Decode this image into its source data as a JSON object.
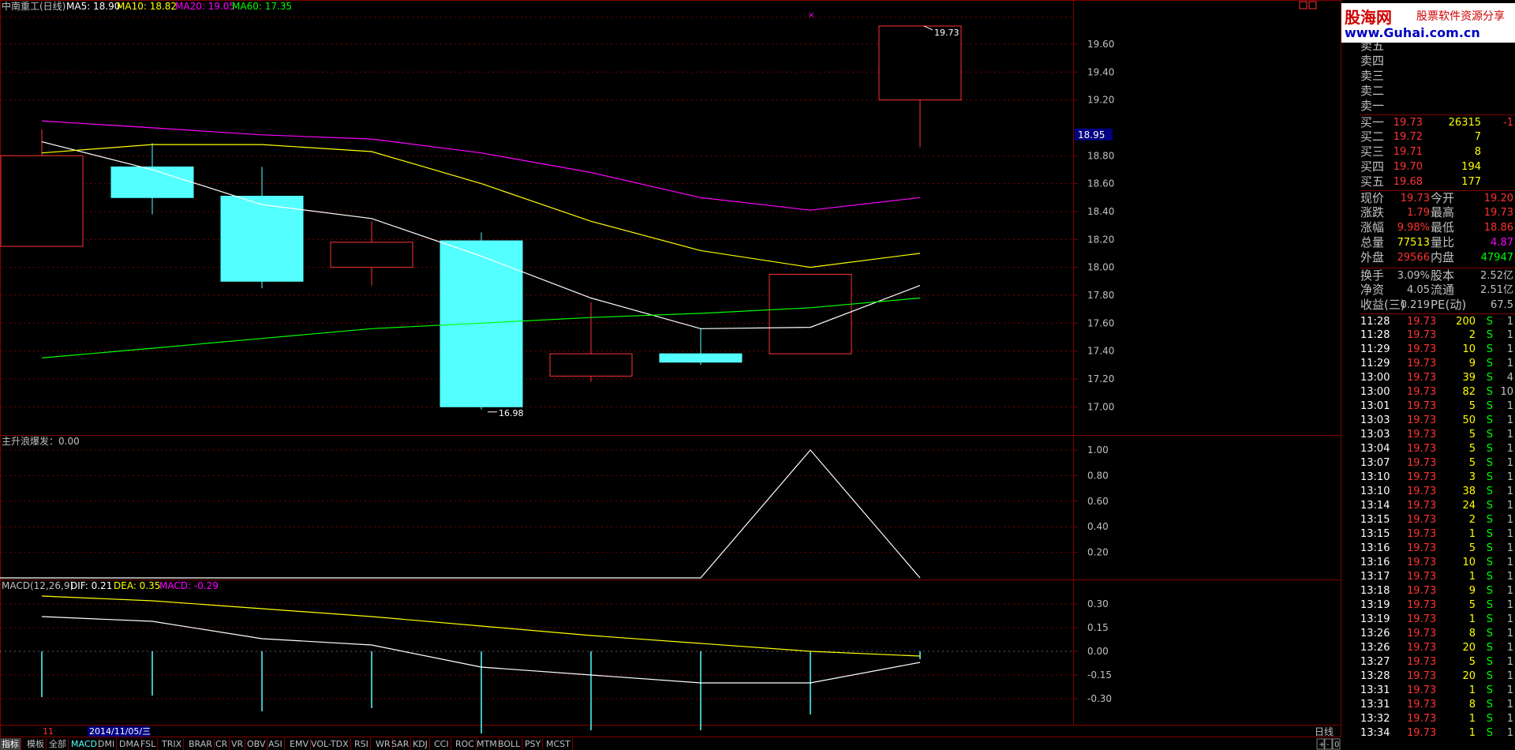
{
  "header": {
    "stock_name": "中南重工(日线)",
    "ma_labels": [
      {
        "text": "MA5: 18.90",
        "color": "#ffffff"
      },
      {
        "text": "MA10: 18.82",
        "color": "#ffff00"
      },
      {
        "text": "MA20: 19.05",
        "color": "#ff00ff"
      },
      {
        "text": "MA60: 17.35",
        "color": "#00ff00"
      }
    ]
  },
  "logo": {
    "title": "股海网",
    "subtitle": "股票软件资源分享",
    "url": "www.Guhai.com.cn"
  },
  "price_axis": {
    "ticks": [
      "19.60",
      "19.40",
      "19.20",
      "18.95",
      "18.80",
      "18.60",
      "18.40",
      "18.20",
      "18.00",
      "17.80",
      "17.60",
      "17.40",
      "17.20",
      "17.00"
    ],
    "highlight": "18.95"
  },
  "candles": [
    {
      "o": 18.8,
      "c": 18.15,
      "h": 18.99,
      "l": 18.15,
      "up": true
    },
    {
      "o": 18.72,
      "c": 18.5,
      "h": 18.89,
      "l": 18.38,
      "up": false
    },
    {
      "o": 18.51,
      "c": 17.9,
      "h": 18.72,
      "l": 17.85,
      "up": false
    },
    {
      "o": 18.0,
      "c": 18.18,
      "h": 18.33,
      "l": 17.87,
      "up": true
    },
    {
      "o": 18.19,
      "c": 17.0,
      "h": 18.25,
      "l": 16.98,
      "up": false
    },
    {
      "o": 17.22,
      "c": 17.38,
      "h": 17.75,
      "l": 17.18,
      "up": true
    },
    {
      "o": 17.38,
      "c": 17.32,
      "h": 17.56,
      "l": 17.3,
      "up": false
    },
    {
      "o": 17.38,
      "c": 17.95,
      "h": 17.95,
      "l": 17.38,
      "up": true
    },
    {
      "o": 19.2,
      "c": 19.73,
      "h": 19.73,
      "l": 18.86,
      "up": true
    }
  ],
  "ma_series": {
    "ma5": [
      18.9,
      18.7,
      18.45,
      18.35,
      18.08,
      17.78,
      17.56,
      17.57,
      17.87
    ],
    "ma10": [
      18.82,
      18.88,
      18.88,
      18.83,
      18.6,
      18.33,
      18.12,
      18.0,
      18.1
    ],
    "ma20": [
      19.05,
      19.0,
      18.95,
      18.92,
      18.82,
      18.68,
      18.5,
      18.41,
      18.5
    ],
    "ma60": [
      17.35,
      17.42,
      17.49,
      17.56,
      17.6,
      17.64,
      17.67,
      17.71,
      17.78
    ]
  },
  "annotations": {
    "high_label": "19.73",
    "low_label": "16.98"
  },
  "indicator1": {
    "label": "主升浪爆发：0.00",
    "ticks": [
      "1.00",
      "0.80",
      "0.60",
      "0.40",
      "0.20"
    ],
    "values": [
      0,
      0,
      0,
      0,
      0,
      0,
      0,
      1,
      0
    ]
  },
  "indicator2": {
    "label_name": "MACD(12,26,9)",
    "dif_label": "DIF: 0.21",
    "dea_label": "DEA: 0.35",
    "macd_label": "MACD: -0.29",
    "ticks": [
      "0.30",
      "0.15",
      "0.00",
      "-0.15",
      "-0.30"
    ],
    "dif": [
      0.22,
      0.19,
      0.08,
      0.04,
      -0.1,
      -0.15,
      -0.2,
      -0.2,
      -0.07
    ],
    "dea": [
      0.35,
      0.32,
      0.27,
      0.22,
      0.16,
      0.1,
      0.05,
      0.0,
      -0.03
    ],
    "macd": [
      -0.29,
      -0.28,
      -0.38,
      -0.36,
      -0.52,
      -0.5,
      -0.5,
      -0.4,
      -0.05
    ]
  },
  "date_bar": {
    "month": "11",
    "date": "2014/11/05/三"
  },
  "tabs": [
    "指标",
    "模板",
    "全部",
    "MACD",
    "DMI",
    "DMA",
    "FSL",
    "TRIX",
    "BRAR",
    "CR",
    "VR",
    "OBV",
    "ASI",
    "EMV",
    "VOL-TDX",
    "RSI",
    "WR",
    "SAR",
    "KDJ",
    "CCI",
    "ROC",
    "MTM",
    "BOLL",
    "PSY",
    "MCST"
  ],
  "active_tab": "MACD",
  "period_label": "日线",
  "corner_buttons": [
    "+",
    "-",
    "0"
  ],
  "orderbook": {
    "asks": [
      "卖五",
      "卖四",
      "卖三",
      "卖二",
      "卖一"
    ],
    "bids": [
      {
        "label": "买一",
        "price": "19.73",
        "vol": "26315",
        "chg": "-1"
      },
      {
        "label": "买二",
        "price": "19.72",
        "vol": "7",
        "chg": ""
      },
      {
        "label": "买三",
        "price": "19.71",
        "vol": "8",
        "chg": ""
      },
      {
        "label": "买四",
        "price": "19.70",
        "vol": "194",
        "chg": ""
      },
      {
        "label": "买五",
        "price": "19.68",
        "vol": "177",
        "chg": ""
      }
    ]
  },
  "quote": [
    {
      "l1": "现价",
      "v1": "19.73",
      "c1": "#ff3232",
      "l2": "今开",
      "v2": "19.20",
      "c2": "#ff3232"
    },
    {
      "l1": "涨跌",
      "v1": "1.79",
      "c1": "#ff3232",
      "l2": "最高",
      "v2": "19.73",
      "c2": "#ff3232"
    },
    {
      "l1": "涨幅",
      "v1": "9.98%",
      "c1": "#ff3232",
      "l2": "最低",
      "v2": "18.86",
      "c2": "#ff3232"
    },
    {
      "l1": "总量",
      "v1": "77513",
      "c1": "#ffff00",
      "l2": "量比",
      "v2": "4.87",
      "c2": "#ff00ff"
    },
    {
      "l1": "外盘",
      "v1": "29566",
      "c1": "#ff3232",
      "l2": "内盘",
      "v2": "47947",
      "c2": "#00ff00"
    }
  ],
  "fundamentals": [
    {
      "l1": "换手",
      "v1": "3.09%",
      "l2": "股本",
      "v2": "2.52亿"
    },
    {
      "l1": "净资",
      "v1": "4.05",
      "l2": "流通",
      "v2": "2.51亿"
    },
    {
      "l1": "收益(三)",
      "v1": "0.219",
      "l2": "PE(动)",
      "v2": "67.5"
    }
  ],
  "ticks": [
    {
      "t": "11:28",
      "p": "19.73",
      "v": "200",
      "s": "S",
      "n": "1"
    },
    {
      "t": "11:28",
      "p": "19.73",
      "v": "2",
      "s": "S",
      "n": "1"
    },
    {
      "t": "11:29",
      "p": "19.73",
      "v": "10",
      "s": "S",
      "n": "1"
    },
    {
      "t": "11:29",
      "p": "19.73",
      "v": "9",
      "s": "S",
      "n": "1"
    },
    {
      "t": "13:00",
      "p": "19.73",
      "v": "39",
      "s": "S",
      "n": "4"
    },
    {
      "t": "13:00",
      "p": "19.73",
      "v": "82",
      "s": "S",
      "n": "10"
    },
    {
      "t": "13:01",
      "p": "19.73",
      "v": "5",
      "s": "S",
      "n": "1"
    },
    {
      "t": "13:03",
      "p": "19.73",
      "v": "50",
      "s": "S",
      "n": "1"
    },
    {
      "t": "13:03",
      "p": "19.73",
      "v": "5",
      "s": "S",
      "n": "1"
    },
    {
      "t": "13:04",
      "p": "19.73",
      "v": "5",
      "s": "S",
      "n": "1"
    },
    {
      "t": "13:07",
      "p": "19.73",
      "v": "5",
      "s": "S",
      "n": "1"
    },
    {
      "t": "13:10",
      "p": "19.73",
      "v": "3",
      "s": "S",
      "n": "1"
    },
    {
      "t": "13:10",
      "p": "19.73",
      "v": "38",
      "s": "S",
      "n": "1"
    },
    {
      "t": "13:14",
      "p": "19.73",
      "v": "24",
      "s": "S",
      "n": "1"
    },
    {
      "t": "13:15",
      "p": "19.73",
      "v": "2",
      "s": "S",
      "n": "1"
    },
    {
      "t": "13:15",
      "p": "19.73",
      "v": "1",
      "s": "S",
      "n": "1"
    },
    {
      "t": "13:16",
      "p": "19.73",
      "v": "5",
      "s": "S",
      "n": "1"
    },
    {
      "t": "13:16",
      "p": "19.73",
      "v": "10",
      "s": "S",
      "n": "1"
    },
    {
      "t": "13:17",
      "p": "19.73",
      "v": "1",
      "s": "S",
      "n": "1"
    },
    {
      "t": "13:18",
      "p": "19.73",
      "v": "9",
      "s": "S",
      "n": "1"
    },
    {
      "t": "13:19",
      "p": "19.73",
      "v": "5",
      "s": "S",
      "n": "1"
    },
    {
      "t": "13:19",
      "p": "19.73",
      "v": "1",
      "s": "S",
      "n": "1"
    },
    {
      "t": "13:26",
      "p": "19.73",
      "v": "8",
      "s": "S",
      "n": "1"
    },
    {
      "t": "13:26",
      "p": "19.73",
      "v": "20",
      "s": "S",
      "n": "1"
    },
    {
      "t": "13:27",
      "p": "19.73",
      "v": "5",
      "s": "S",
      "n": "1"
    },
    {
      "t": "13:28",
      "p": "19.73",
      "v": "20",
      "s": "S",
      "n": "1"
    },
    {
      "t": "13:31",
      "p": "19.73",
      "v": "1",
      "s": "S",
      "n": "1"
    },
    {
      "t": "13:31",
      "p": "19.73",
      "v": "8",
      "s": "S",
      "n": "1"
    },
    {
      "t": "13:32",
      "p": "19.73",
      "v": "1",
      "s": "S",
      "n": "1"
    },
    {
      "t": "13:34",
      "p": "19.73",
      "v": "1",
      "s": "S",
      "n": "1"
    }
  ],
  "colors": {
    "up": "#ff3232",
    "down": "#54ffff",
    "grid": "#800000",
    "axis": "#c0c0c0",
    "ma5": "#ffffff",
    "ma10": "#ffff00",
    "ma20": "#ff00ff",
    "ma60": "#00ff00",
    "buy_vol": "#ffff00",
    "sell_flag": "#00ff00"
  }
}
